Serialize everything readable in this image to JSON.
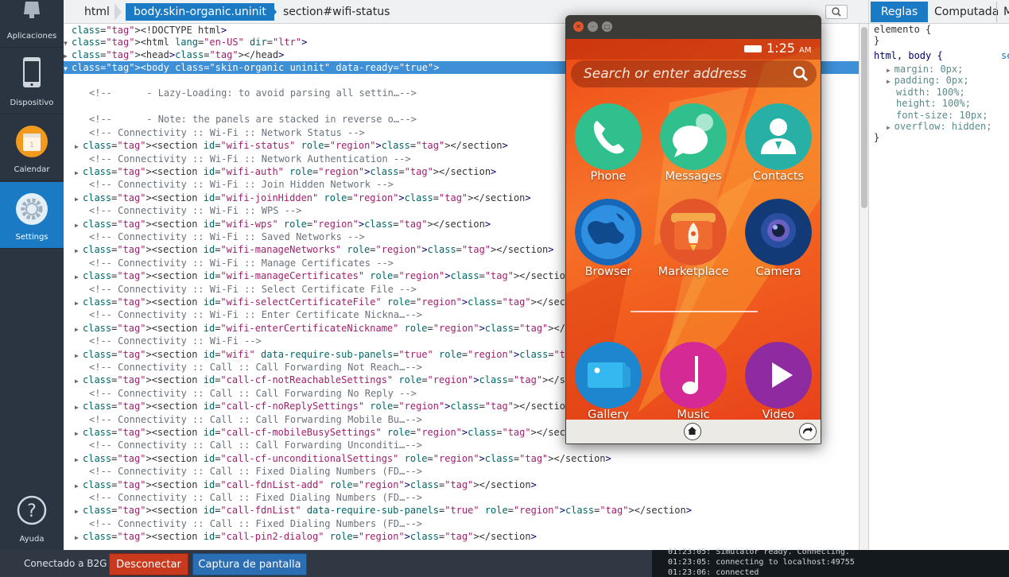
{
  "sidebar": {
    "items": [
      {
        "label": "Aplicaciones",
        "icon": "apps-icon"
      },
      {
        "label": "Dispositivo",
        "icon": "phone-device-icon"
      },
      {
        "label": "Calendar",
        "icon": "calendar-icon"
      },
      {
        "label": "Settings",
        "icon": "settings-gear-icon",
        "active": true
      },
      {
        "label": "Ayuda",
        "icon": "help-icon"
      }
    ]
  },
  "breadcrumbs": [
    "html",
    "body.skin-organic.uninit",
    "section#wifi-status"
  ],
  "markup": {
    "lines": [
      {
        "t": "<!DOCTYPE html>",
        "kind": "plain"
      },
      {
        "t": "<html lang=\"en-US\" dir=\"ltr\">",
        "kind": "plain"
      },
      {
        "t": "<head></head>",
        "kind": "plain"
      },
      {
        "t": "<body class=\"skin-organic uninit\" data-ready=\"true\">",
        "kind": "plain"
      },
      {
        "t": "",
        "kind": "plain"
      },
      {
        "t": "<!--      - Lazy-Loading: to avoid parsing all settin…-->",
        "kind": "comment"
      },
      {
        "t": "",
        "kind": "plain"
      },
      {
        "t": "<!--      - Note: the panels are stacked in reverse o…-->",
        "kind": "comment"
      },
      {
        "t": "<!-- Connectivity :: Wi-Fi :: Network Status -->",
        "kind": "comment"
      },
      {
        "t": "<section id=\"wifi-status\" role=\"region\"></section>",
        "kind": "plain"
      },
      {
        "t": "<!-- Connectivity :: Wi-Fi :: Network Authentication -->",
        "kind": "comment"
      },
      {
        "t": "<section id=\"wifi-auth\" role=\"region\"></section>",
        "kind": "plain"
      },
      {
        "t": "<!-- Connectivity :: Wi-Fi :: Join Hidden Network -->",
        "kind": "comment"
      },
      {
        "t": "<section id=\"wifi-joinHidden\" role=\"region\"></section>",
        "kind": "plain"
      },
      {
        "t": "<!-- Connectivity :: Wi-Fi :: WPS -->",
        "kind": "comment"
      },
      {
        "t": "<section id=\"wifi-wps\" role=\"region\"></section>",
        "kind": "plain"
      },
      {
        "t": "<!-- Connectivity :: Wi-Fi :: Saved Networks -->",
        "kind": "comment"
      },
      {
        "t": "<section id=\"wifi-manageNetworks\" role=\"region\"></section>",
        "kind": "plain"
      },
      {
        "t": "<!-- Connectivity :: Wi-Fi :: Manage Certificates -->",
        "kind": "comment"
      },
      {
        "t": "<section id=\"wifi-manageCertificates\" role=\"region\"></section>",
        "kind": "plain"
      },
      {
        "t": "<!-- Connectivity :: Wi-Fi :: Select Certificate File -->",
        "kind": "comment"
      },
      {
        "t": "<section id=\"wifi-selectCertificateFile\" role=\"region\"></section>",
        "kind": "plain"
      },
      {
        "t": "<!-- Connectivity :: Wi-Fi :: Enter Certificate Nickna…-->",
        "kind": "comment"
      },
      {
        "t": "<section id=\"wifi-enterCertificateNickname\" role=\"region\"></section>",
        "kind": "plain"
      },
      {
        "t": "<!-- Connectivity :: Wi-Fi -->",
        "kind": "comment"
      },
      {
        "t": "<section id=\"wifi\" data-require-sub-panels=\"true\" role=\"region\"></section>",
        "kind": "plain"
      },
      {
        "t": "<!-- Connectivity :: Call :: Call Forwarding Not Reach…-->",
        "kind": "comment"
      },
      {
        "t": "<section id=\"call-cf-notReachableSettings\" role=\"region\"></section>",
        "kind": "plain"
      },
      {
        "t": "<!-- Connectivity :: Call :: Call Forwarding No Reply -->",
        "kind": "comment"
      },
      {
        "t": "<section id=\"call-cf-noReplySettings\" role=\"region\"></section>",
        "kind": "plain"
      },
      {
        "t": "<!-- Connectivity :: Call :: Call Forwarding Mobile Bu…-->",
        "kind": "comment"
      },
      {
        "t": "<section id=\"call-cf-mobileBusySettings\" role=\"region\"></section>",
        "kind": "plain"
      },
      {
        "t": "<!-- Connectivity :: Call :: Call Forwarding Unconditi…-->",
        "kind": "comment"
      },
      {
        "t": "<section id=\"call-cf-unconditionalSettings\" role=\"region\"></section>",
        "kind": "plain"
      },
      {
        "t": "<!-- Connectivity :: Call :: Fixed Dialing Numbers (FD…-->",
        "kind": "comment"
      },
      {
        "t": "<section id=\"call-fdnList-add\" role=\"region\"></section>",
        "kind": "plain"
      },
      {
        "t": "<!-- Connectivity :: Call :: Fixed Dialing Numbers (FD…-->",
        "kind": "comment"
      },
      {
        "t": "<section id=\"call-fdnList\" data-require-sub-panels=\"true\" role=\"region\"></section>",
        "kind": "plain"
      },
      {
        "t": "<!-- Connectivity :: Call :: Fixed Dialing Numbers (FD…-->",
        "kind": "comment"
      },
      {
        "t": "<section id=\"call-pin2-dialog\" role=\"region\"></section>",
        "kind": "plain"
      }
    ]
  },
  "rules_pane": {
    "tabs": [
      "Reglas",
      "Computada",
      "M"
    ],
    "lines": [
      "elemento {",
      "}",
      "html, body {",
      "margin: 0px;",
      "padding: 0px;",
      "width: 100%;",
      "height: 100%;",
      "font-size: 10px;",
      "overflow: hidden;",
      "}"
    ],
    "source": "se"
  },
  "statusbar": {
    "connected_text": "Conectado a B2G",
    "disconnect_label": "Desconectar",
    "screenshot_label": "Captura de pantalla"
  },
  "console": {
    "lines": [
      "01:23:05: Simulator ready. Connecting.",
      "01:23:05: connecting to localhost:49755",
      "01:23:06: connected"
    ]
  },
  "phone": {
    "time": "1:25",
    "ampm": "AM",
    "search_placeholder": "Search or enter address",
    "apps": [
      {
        "label": "Phone",
        "icon": "phone-handset-icon",
        "color": "#2fc08e"
      },
      {
        "label": "Messages",
        "icon": "messages-bubble-icon",
        "color": "#2fc08e"
      },
      {
        "label": "Contacts",
        "icon": "contacts-person-icon",
        "color": "#27b0a5"
      },
      {
        "label": "Browser",
        "icon": "browser-globe-icon",
        "color": "#1667b8"
      },
      {
        "label": "Marketplace",
        "icon": "marketplace-rocket-icon",
        "color": "#e5552a"
      },
      {
        "label": "Camera",
        "icon": "camera-lens-icon",
        "color": "#123a77"
      },
      {
        "label": "Gallery",
        "icon": "gallery-photo-icon",
        "color": "#1c86cf"
      },
      {
        "label": "Music",
        "icon": "music-note-icon",
        "color": "#d42a95"
      },
      {
        "label": "Video",
        "icon": "video-play-icon",
        "color": "#8e2ba0"
      }
    ]
  },
  "colors": {
    "accent": "#1a7ac4",
    "sidebar": "#2b3541",
    "disconnect": "#c9391d",
    "phone_bg": "#f25f1f"
  }
}
